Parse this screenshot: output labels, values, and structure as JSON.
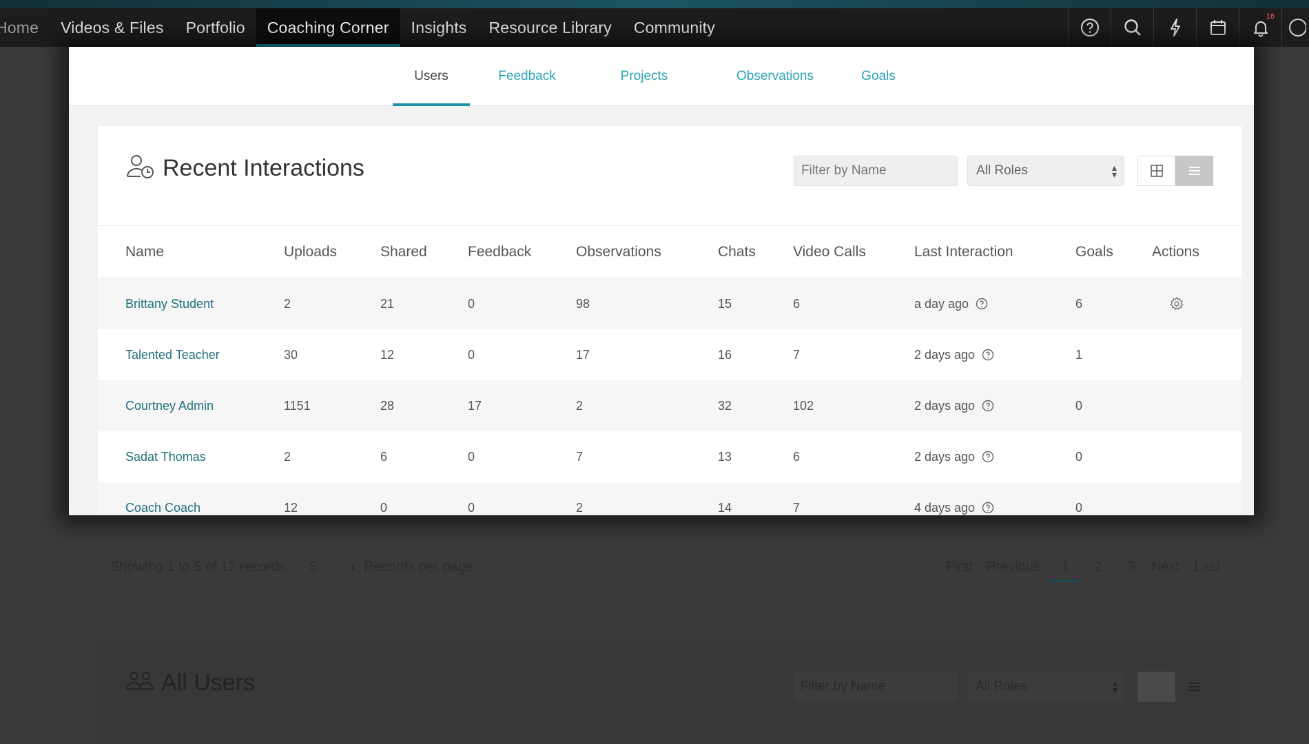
{
  "nav": {
    "items": [
      {
        "label": "Home",
        "active": false
      },
      {
        "label": "Videos & Files",
        "active": false
      },
      {
        "label": "Portfolio",
        "active": false
      },
      {
        "label": "Coaching Corner",
        "active": true
      },
      {
        "label": "Insights",
        "active": false
      },
      {
        "label": "Resource Library",
        "active": false
      },
      {
        "label": "Community",
        "active": false
      }
    ],
    "icons": [
      "help-icon",
      "search-icon",
      "lightning-icon",
      "calendar-icon",
      "bell-icon",
      "avatar-icon"
    ],
    "notification_count": "16"
  },
  "subtabs": [
    {
      "label": "Users",
      "active": true
    },
    {
      "label": "Feedback",
      "active": false
    },
    {
      "label": "Projects",
      "active": false
    },
    {
      "label": "Observations",
      "active": false
    },
    {
      "label": "Goals",
      "active": false
    }
  ],
  "recent": {
    "title": "Recent Interactions",
    "icon": "user-clock-icon",
    "filter_placeholder": "Filter by Name",
    "role_value": "All Roles",
    "view_modes": [
      "grid-view-icon",
      "list-view-icon"
    ],
    "columns": [
      "Name",
      "Uploads",
      "Shared",
      "Feedback",
      "Observations",
      "Chats",
      "Video Calls",
      "Last Interaction",
      "Goals",
      "Actions"
    ],
    "rows": [
      {
        "name": "Brittany Student",
        "uploads": "2",
        "shared": "21",
        "feedback": "0",
        "observations": "98",
        "chats": "15",
        "video_calls": "6",
        "last": "a day ago",
        "goals": "6",
        "has_action": true
      },
      {
        "name": "Talented Teacher",
        "uploads": "30",
        "shared": "12",
        "feedback": "0",
        "observations": "17",
        "chats": "16",
        "video_calls": "7",
        "last": "2 days ago",
        "goals": "1",
        "has_action": false
      },
      {
        "name": "Courtney Admin",
        "uploads": "1151",
        "shared": "28",
        "feedback": "17",
        "observations": "2",
        "chats": "32",
        "video_calls": "102",
        "last": "2 days ago",
        "goals": "0",
        "has_action": false
      },
      {
        "name": "Sadat Thomas",
        "uploads": "2",
        "shared": "6",
        "feedback": "0",
        "observations": "7",
        "chats": "13",
        "video_calls": "6",
        "last": "2 days ago",
        "goals": "0",
        "has_action": false
      },
      {
        "name": "Coach Coach",
        "uploads": "12",
        "shared": "0",
        "feedback": "0",
        "observations": "2",
        "chats": "14",
        "video_calls": "7",
        "last": "4 days ago",
        "goals": "0",
        "has_action": false
      }
    ]
  },
  "pager": {
    "showing": "Showing 1 to 5 of 12 records",
    "per_page_value": "5",
    "per_page_label": "Records per page",
    "first": "First",
    "previous": "Previous",
    "pages": [
      "1",
      "2",
      "3"
    ],
    "current_page": "1",
    "next": "Next",
    "last": "Last"
  },
  "all_users": {
    "title": "All Users",
    "icon": "users-group-icon",
    "filter_placeholder": "Filter by Name",
    "role_value": "All Roles"
  },
  "colors": {
    "accent": "#1d93a8",
    "link": "#2aa3b3",
    "name_link": "#1f6f7e",
    "nav_bg": "#1d1d1d"
  }
}
